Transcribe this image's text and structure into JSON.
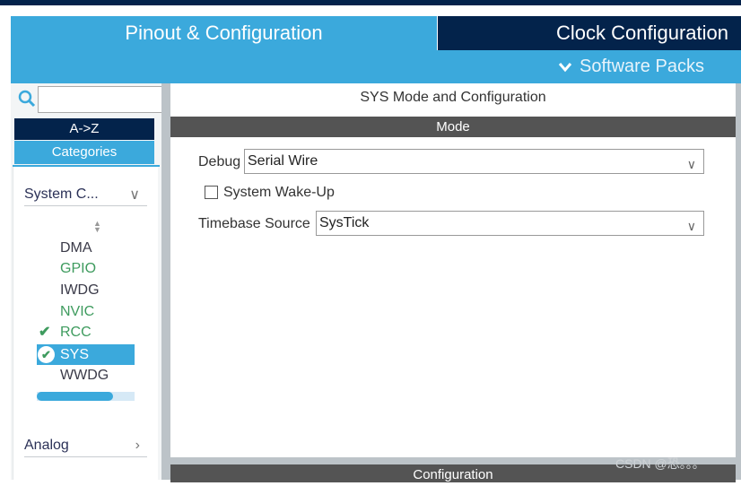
{
  "tabs": [
    {
      "label": "Pinout & Configuration",
      "active": true
    },
    {
      "label": "Clock Configuration",
      "active": false
    }
  ],
  "software_packs": "Software Packs",
  "sidebar": {
    "search": {
      "value": "",
      "placeholder": ""
    },
    "sort_az": "A->Z",
    "categories": "Categories",
    "groups": [
      {
        "label": "System C...",
        "expanded": true
      },
      {
        "label": "Analog",
        "expanded": false
      }
    ],
    "items": [
      {
        "label": "DMA",
        "status": "plain"
      },
      {
        "label": "GPIO",
        "status": "ok"
      },
      {
        "label": "IWDG",
        "status": "plain"
      },
      {
        "label": "NVIC",
        "status": "ok"
      },
      {
        "label": "RCC",
        "status": "ok",
        "check": true
      },
      {
        "label": "SYS",
        "status": "selected",
        "check": true
      },
      {
        "label": "WWDG",
        "status": "plain"
      }
    ],
    "scroll_fraction": 0.78
  },
  "main": {
    "title": "SYS Mode and Configuration",
    "mode_header": "Mode",
    "debug_label": "Debug",
    "debug_value": "Serial Wire",
    "wakeup_label": "System Wake-Up",
    "wakeup_checked": false,
    "timebase_label": "Timebase Source",
    "timebase_value": "SysTick",
    "config_header": "Configuration"
  },
  "watermark": "CSDN @恐。。。",
  "colors": {
    "accent": "#3ba9dc",
    "navy": "#03234b",
    "ok": "#3e9b5e"
  }
}
